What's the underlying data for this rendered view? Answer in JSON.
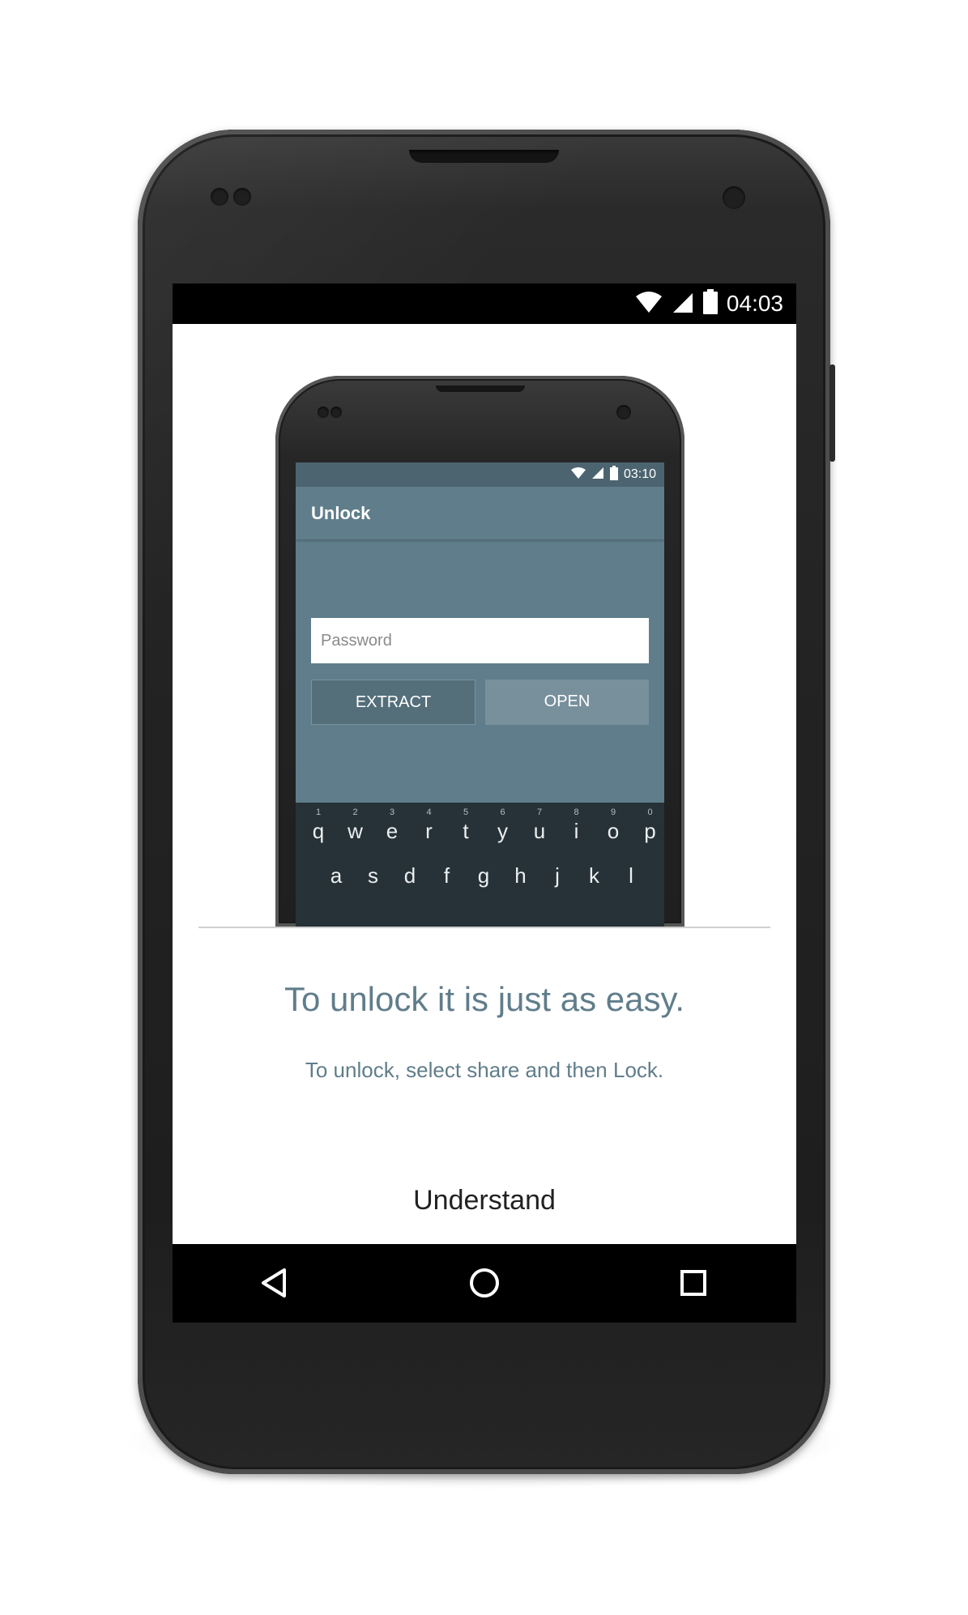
{
  "status_bar": {
    "time": "04:03",
    "icons": [
      "wifi-icon",
      "cell-signal-icon",
      "battery-icon"
    ]
  },
  "illustration": {
    "status_bar": {
      "time": "03:10"
    },
    "toolbar": {
      "title": "Unlock"
    },
    "password": {
      "placeholder": "Password"
    },
    "buttons": {
      "extract": "EXTRACT",
      "open": "OPEN"
    },
    "keyboard": {
      "row1": [
        {
          "hint": "1",
          "key": "q"
        },
        {
          "hint": "2",
          "key": "w"
        },
        {
          "hint": "3",
          "key": "e"
        },
        {
          "hint": "4",
          "key": "r"
        },
        {
          "hint": "5",
          "key": "t"
        },
        {
          "hint": "6",
          "key": "y"
        },
        {
          "hint": "7",
          "key": "u"
        },
        {
          "hint": "8",
          "key": "i"
        },
        {
          "hint": "9",
          "key": "o"
        },
        {
          "hint": "0",
          "key": "p"
        }
      ],
      "row2": [
        "a",
        "s",
        "d",
        "f",
        "g",
        "h",
        "j",
        "k",
        "l"
      ]
    }
  },
  "main": {
    "headline": "To unlock it is just as easy.",
    "subline": "To unlock, select share and then Lock.",
    "understand_label": "Understand"
  },
  "nav_bar": {
    "buttons": [
      "back-icon",
      "home-icon",
      "recents-icon"
    ]
  },
  "colors": {
    "accent": "#607d8b",
    "toolbar": "#607d8b",
    "keyboard": "#263238"
  }
}
